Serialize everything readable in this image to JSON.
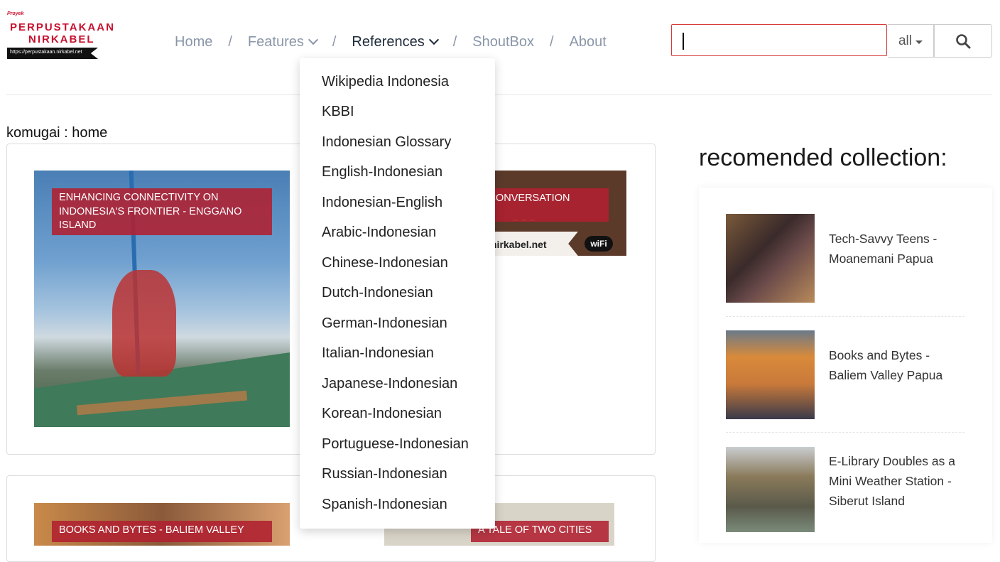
{
  "logo": {
    "proyek": "Proyek",
    "line1": "PERPUSTAKAAN",
    "line2": "NIRKABEL",
    "url": "https://perpustakaan.nirkabel.net"
  },
  "nav": {
    "home": "Home",
    "features": "Features",
    "references": "References",
    "shoutbox": "ShoutBox",
    "about": "About",
    "separator": "/"
  },
  "search": {
    "value": "",
    "select_value": "all",
    "icon": "search-icon"
  },
  "breadcrumb": "komugai : home",
  "cards": [
    {
      "badge": "ENHANCING CONNECTIVITY ON INDONESIA'S FRONTIER - ENGGANO ISLAND"
    },
    {
      "badge": "N CONVERSATION",
      "image_url_text": "nirkabel.net",
      "image_wifi": "wiFi"
    },
    {
      "badge": "BOOKS AND BYTES - BALIEM VALLEY"
    },
    {
      "badge": "A TALE OF TWO CITIES"
    }
  ],
  "references_menu": [
    "Wikipedia Indonesia",
    "KBBI",
    "Indonesian Glossary",
    "English-Indonesian",
    "Indonesian-English",
    "Arabic-Indonesian",
    "Chinese-Indonesian",
    "Dutch-Indonesian",
    "German-Indonesian",
    "Italian-Indonesian",
    "Japanese-Indonesian",
    "Korean-Indonesian",
    "Portuguese-Indonesian",
    "Russian-Indonesian",
    "Spanish-Indonesian"
  ],
  "sidebar": {
    "title": "recomended collection:",
    "items": [
      {
        "title": "Tech-Savvy Teens - Moanemani Papua"
      },
      {
        "title": "Books and Bytes - Baliem Valley Papua"
      },
      {
        "title": "E-Library Doubles as a Mini Weather Station - Siberut Island"
      }
    ]
  },
  "colors": {
    "accent_red": "#c8102e",
    "badge_bg": "#b02030",
    "nav_text": "#8a96a8",
    "nav_active": "#1e2a3a"
  }
}
